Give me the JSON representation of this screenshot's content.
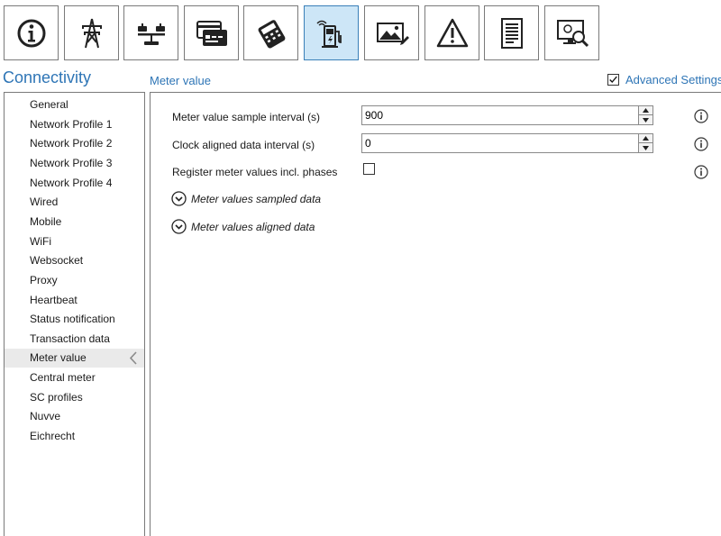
{
  "toolbar": {
    "buttons": [
      {
        "icon": "info-icon",
        "active": false
      },
      {
        "icon": "power-tower-icon",
        "active": false
      },
      {
        "icon": "scale-icon",
        "active": false
      },
      {
        "icon": "card-reader-icon",
        "active": false
      },
      {
        "icon": "payment-terminal-icon",
        "active": false
      },
      {
        "icon": "charging-station-icon",
        "active": true
      },
      {
        "icon": "image-icon",
        "active": false
      },
      {
        "icon": "warning-icon",
        "active": false
      },
      {
        "icon": "document-icon",
        "active": false
      },
      {
        "icon": "monitor-search-icon",
        "active": false
      }
    ]
  },
  "sidebar": {
    "title": "Connectivity",
    "items": [
      {
        "label": "General"
      },
      {
        "label": "Network Profile 1"
      },
      {
        "label": "Network Profile 2"
      },
      {
        "label": "Network Profile 3"
      },
      {
        "label": "Network Profile 4"
      },
      {
        "label": "Wired"
      },
      {
        "label": "Mobile"
      },
      {
        "label": "WiFi"
      },
      {
        "label": "Websocket"
      },
      {
        "label": "Proxy"
      },
      {
        "label": "Heartbeat"
      },
      {
        "label": "Status notification"
      },
      {
        "label": "Transaction data"
      },
      {
        "label": "Meter value",
        "selected": true
      },
      {
        "label": "Central meter"
      },
      {
        "label": "SC profiles"
      },
      {
        "label": "Nuvve"
      },
      {
        "label": "Eichrecht"
      }
    ]
  },
  "main": {
    "title": "Meter value",
    "advanced_settings": {
      "label": "Advanced Settings",
      "checked": true
    },
    "fields": {
      "sample_interval": {
        "label": "Meter value sample interval (s)",
        "value": "900"
      },
      "clock_aligned": {
        "label": "Clock aligned data interval (s)",
        "value": "0"
      },
      "register_phases": {
        "label": "Register meter values incl. phases",
        "checked": false
      }
    },
    "expanders": {
      "sampled": {
        "label": "Meter values sampled data"
      },
      "aligned": {
        "label": "Meter values aligned data"
      }
    }
  },
  "colors": {
    "accent": "#2e75b6",
    "active_tool_bg": "#cde6f7",
    "border": "#7a7a7a",
    "selected_nav_bg": "#eaeaea"
  }
}
